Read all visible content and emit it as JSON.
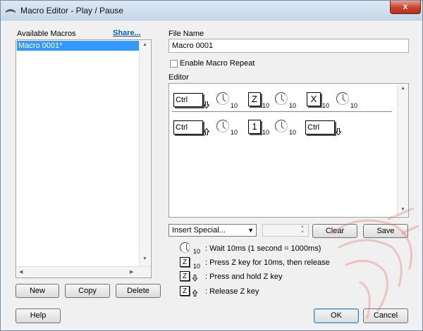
{
  "window": {
    "title": "Macro Editor - Play / Pause",
    "close_glyph": "x"
  },
  "macros": {
    "label": "Available Macros",
    "share_link": "Share...",
    "items": [
      "Macro 0001*"
    ]
  },
  "buttons": {
    "new": "New",
    "copy": "Copy",
    "delete": "Delete",
    "help": "Help",
    "ok": "OK",
    "cancel": "Cancel",
    "clear": "Clear",
    "save": "Save"
  },
  "file": {
    "label": "File Name",
    "value": "Macro 0001"
  },
  "repeat": {
    "label": "Enable Macro Repeat",
    "checked": false
  },
  "editor": {
    "label": "Editor",
    "row1": {
      "ctrl": "Ctrl",
      "z": "Z",
      "x": "X",
      "t1": "10",
      "t2": "10",
      "t3": "10",
      "t4": "10",
      "t5": "10"
    },
    "row2": {
      "ctrl_a": "Ctrl",
      "one": "1",
      "ctrl_b": "Ctrl",
      "t1": "10",
      "t2": "10"
    }
  },
  "insert_special": {
    "value": "Insert Special..."
  },
  "legend": {
    "wait": {
      "sub": "10",
      "text": ": Wait 10ms (1 second = 1000ms)"
    },
    "press": {
      "key": "Z",
      "sub": "10",
      "text": ": Press Z key for 10ms, then release"
    },
    "hold": {
      "key": "Z",
      "text": ": Press and hold Z key"
    },
    "release": {
      "key": "Z",
      "text": ": Release Z key"
    }
  }
}
